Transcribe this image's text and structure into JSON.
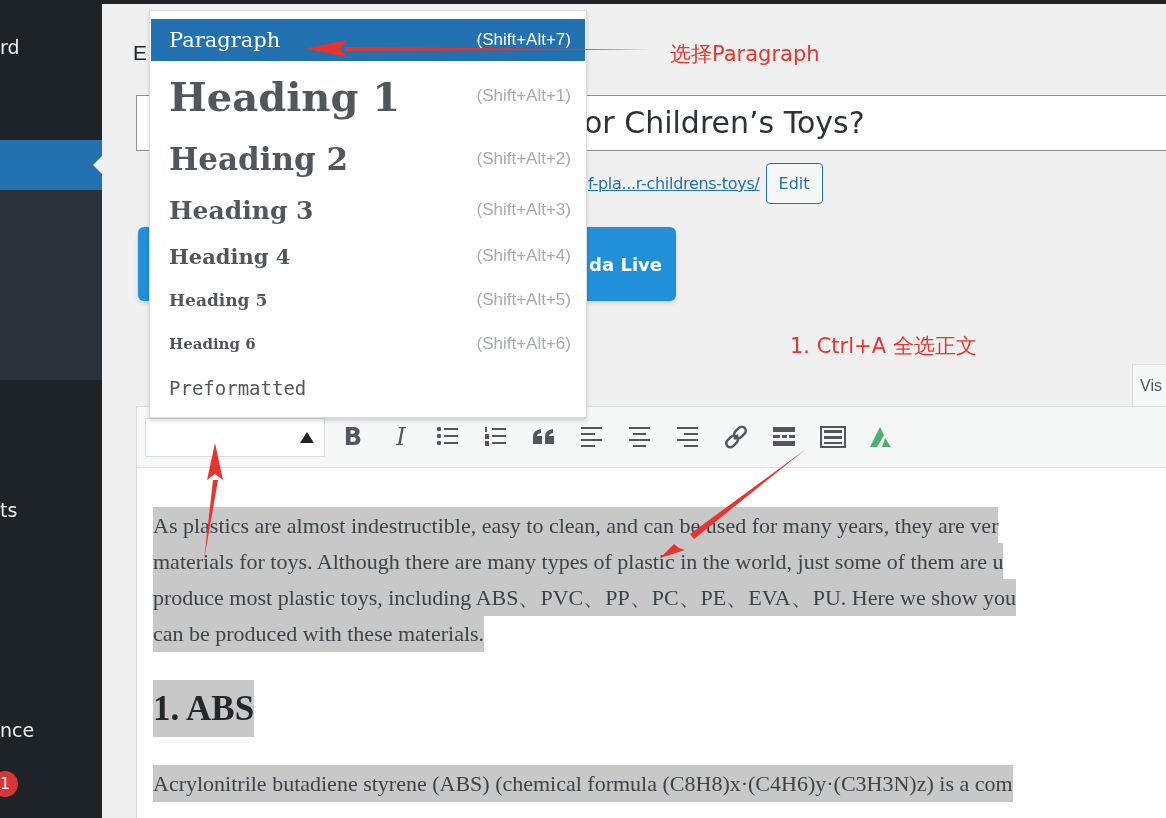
{
  "sidebar": {
    "items": [
      {
        "label": "rd",
        "selected": false
      },
      {
        "selected": true
      },
      {
        "label": "ts",
        "selected": false
      },
      {
        "label": "nce",
        "selected": false
      },
      {
        "badge": "1",
        "selected": false
      }
    ]
  },
  "page_heading": "E",
  "title_field": {
    "value": "or Children’s Toys?"
  },
  "permalink": {
    "link": "f-pla...r-childrens-toys/",
    "button": "Edit"
  },
  "builder_button": "da Live",
  "annotations": [
    {
      "kind": "top",
      "text": "选择Paragraph"
    },
    {
      "kind": "middle",
      "text": "1. Ctrl+A 全选正文"
    }
  ],
  "editor_tabs": [
    {
      "label": "Vis",
      "selected": true
    }
  ],
  "format_menu": {
    "items": [
      {
        "kind": "p",
        "label": "Paragraph",
        "shortcut": "(Shift+Alt+7)",
        "selected": true
      },
      {
        "kind": "h1",
        "label": "Heading 1",
        "shortcut": "(Shift+Alt+1)",
        "selected": false
      },
      {
        "kind": "h2",
        "label": "Heading 2",
        "shortcut": "(Shift+Alt+2)",
        "selected": false
      },
      {
        "kind": "h3",
        "label": "Heading 3",
        "shortcut": "(Shift+Alt+3)",
        "selected": false
      },
      {
        "kind": "h4",
        "label": "Heading 4",
        "shortcut": "(Shift+Alt+4)",
        "selected": false
      },
      {
        "kind": "h5",
        "label": "Heading 5",
        "shortcut": "(Shift+Alt+5)",
        "selected": false
      },
      {
        "kind": "h6",
        "label": "Heading 6",
        "shortcut": "(Shift+Alt+6)",
        "selected": false
      },
      {
        "kind": "pre",
        "label": "Preformatted",
        "selected": false
      }
    ]
  },
  "toolbar": [
    {
      "kind": "bold",
      "glyph": "B"
    },
    {
      "kind": "italic",
      "glyph": "I"
    },
    {
      "kind": "bullet-list"
    },
    {
      "kind": "numbered-list"
    },
    {
      "kind": "quote"
    },
    {
      "kind": "align-left"
    },
    {
      "kind": "align-center"
    },
    {
      "kind": "align-right"
    },
    {
      "kind": "link"
    },
    {
      "kind": "read-more"
    },
    {
      "kind": "toolbar-toggle"
    },
    {
      "kind": "logo"
    }
  ],
  "content": [
    {
      "kind": "paragraph",
      "lines": [
        "As plastics are almost indestructible, easy to clean, and can be used for many years, they are ver",
        "materials for toys. Although there are many types of plastic in the world, just some of them are u",
        "produce most plastic toys, including ABS、PVC、PP、PC、PE、EVA、PU. Here we show you",
        "can be produced with these materials."
      ]
    },
    {
      "kind": "heading",
      "lines": [
        "1. ABS"
      ]
    },
    {
      "kind": "paragraph",
      "lines": [
        "Acrylonitrile butadiene styrene (ABS) (chemical formula (C8H8)x·(C4H6)y·(C3H3N)z) is a com"
      ]
    }
  ]
}
